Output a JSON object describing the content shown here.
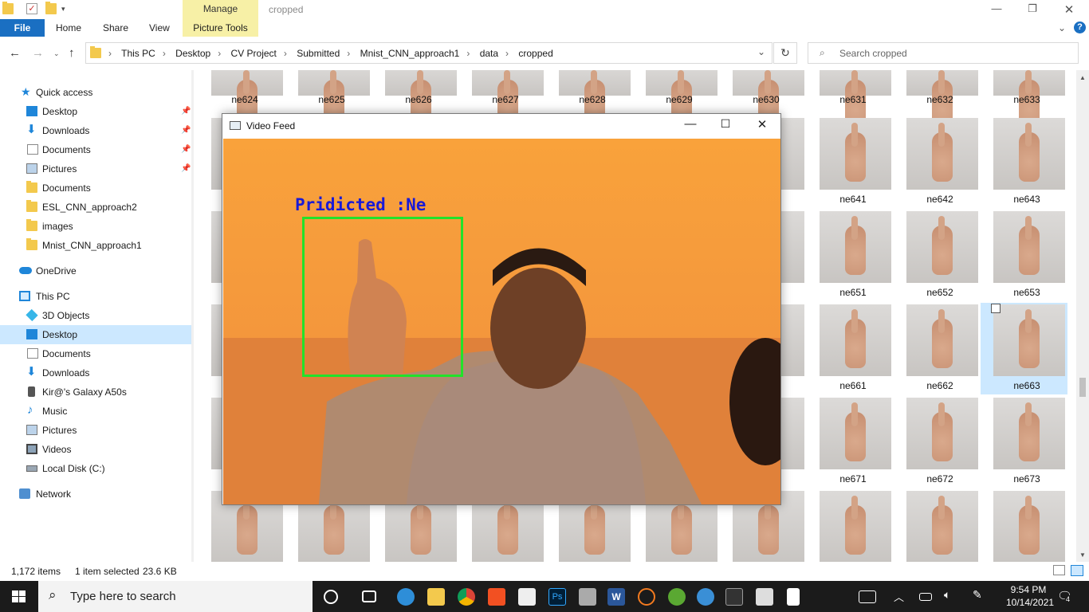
{
  "window": {
    "title": "cropped",
    "manage_tab": "Manage",
    "picture_tools": "Picture Tools"
  },
  "ribbon": {
    "file": "File",
    "home": "Home",
    "share": "Share",
    "view": "View"
  },
  "address": {
    "crumbs": [
      "This PC",
      "Desktop",
      "CV Project",
      "Submitted",
      "Mnist_CNN_approach1",
      "data",
      "cropped"
    ],
    "search_placeholder": "Search cropped"
  },
  "sidebar": {
    "quick_access": "Quick access",
    "quick_items": [
      "Desktop",
      "Downloads",
      "Documents",
      "Pictures",
      "Documents",
      "ESL_CNN_approach2",
      "images",
      "Mnist_CNN_approach1"
    ],
    "onedrive": "OneDrive",
    "this_pc": "This PC",
    "pc_items": [
      "3D Objects",
      "Desktop",
      "Documents",
      "Downloads",
      "Kir@'s Galaxy A50s",
      "Music",
      "Pictures",
      "Videos",
      "Local Disk (C:)"
    ],
    "network": "Network"
  },
  "grid": {
    "row1": [
      "ne624",
      "ne625",
      "ne626",
      "ne627",
      "ne628",
      "ne629",
      "ne630",
      "ne631",
      "ne632",
      "ne633"
    ],
    "row2": [
      "ne641",
      "ne642",
      "ne643"
    ],
    "row3": [
      "ne651",
      "ne652",
      "ne653"
    ],
    "row4": [
      "ne661",
      "ne662",
      "ne663"
    ],
    "row5": [
      "ne671",
      "ne672",
      "ne673"
    ],
    "selected": "ne663"
  },
  "status": {
    "items": "1,172 items",
    "selection": "1 item selected",
    "size": "23.6 KB"
  },
  "video_feed": {
    "title": "Video Feed",
    "prediction": "Pridicted :Ne"
  },
  "taskbar": {
    "search_placeholder": "Type here to search",
    "time": "9:54 PM",
    "date": "10/14/2021",
    "notifications": "4"
  }
}
